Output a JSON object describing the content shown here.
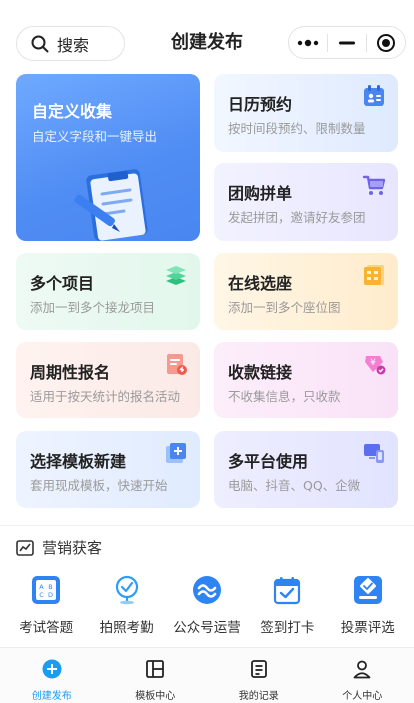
{
  "header": {
    "search_label": "搜索",
    "title": "创建发布"
  },
  "cards": {
    "custom": {
      "title": "自定义收集",
      "subtitle": "自定义字段和一键导出"
    },
    "calendar": {
      "title": "日历预约",
      "subtitle": "按时间段预约、限制数量"
    },
    "group_buy": {
      "title": "团购拼单",
      "subtitle": "发起拼团，邀请好友参团"
    },
    "multi": {
      "title": "多个项目",
      "subtitle": "添加一到多个接龙项目"
    },
    "seat": {
      "title": "在线选座",
      "subtitle": "添加一到多个座位图"
    },
    "periodic": {
      "title": "周期性报名",
      "subtitle": "适用于按天统计的报名活动"
    },
    "payment": {
      "title": "收款链接",
      "subtitle": "不收集信息，只收款"
    },
    "template": {
      "title": "选择模板新建",
      "subtitle": "套用现成模板，快速开始"
    },
    "platform": {
      "title": "多平台使用",
      "subtitle": "电脑、抖音、QQ、企微"
    }
  },
  "marketing": {
    "title": "营销获客",
    "items": [
      {
        "label": "考试答题",
        "icon": "exam-icon"
      },
      {
        "label": "拍照考勤",
        "icon": "photo-attendance-icon"
      },
      {
        "label": "公众号运营",
        "icon": "official-account-icon"
      },
      {
        "label": "签到打卡",
        "icon": "checkin-icon"
      },
      {
        "label": "投票评选",
        "icon": "vote-icon"
      }
    ]
  },
  "tabbar": {
    "items": [
      {
        "label": "创建发布",
        "icon": "plus-circle-icon",
        "active": true
      },
      {
        "label": "模板中心",
        "icon": "template-icon",
        "active": false
      },
      {
        "label": "我的记录",
        "icon": "records-icon",
        "active": false
      },
      {
        "label": "个人中心",
        "icon": "user-icon",
        "active": false
      }
    ]
  },
  "colors": {
    "accent": "#1a9cf0",
    "brand_blue": "#2f84f3"
  }
}
